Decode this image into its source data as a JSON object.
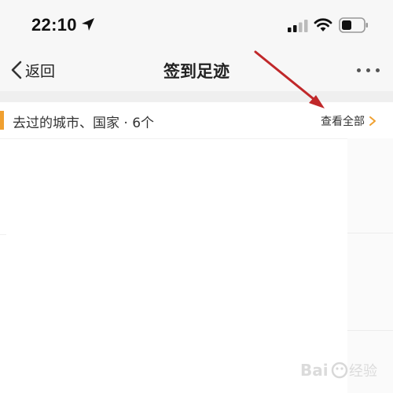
{
  "status_bar": {
    "time": "22:10",
    "icons": [
      "location-arrow-icon",
      "cellular-signal-icon",
      "wifi-icon",
      "battery-icon"
    ]
  },
  "nav": {
    "back_label": "返回",
    "title": "签到足迹",
    "more_icon": "more-dots-icon"
  },
  "section": {
    "label": "去过的城市、国家 · 6个",
    "view_all": "查看全部",
    "accent_color": "#f0a030",
    "chevron_color": "#f0a030"
  },
  "annotation": {
    "arrow_color": "#c0282a"
  },
  "watermark": {
    "text": "Bai 经验"
  }
}
